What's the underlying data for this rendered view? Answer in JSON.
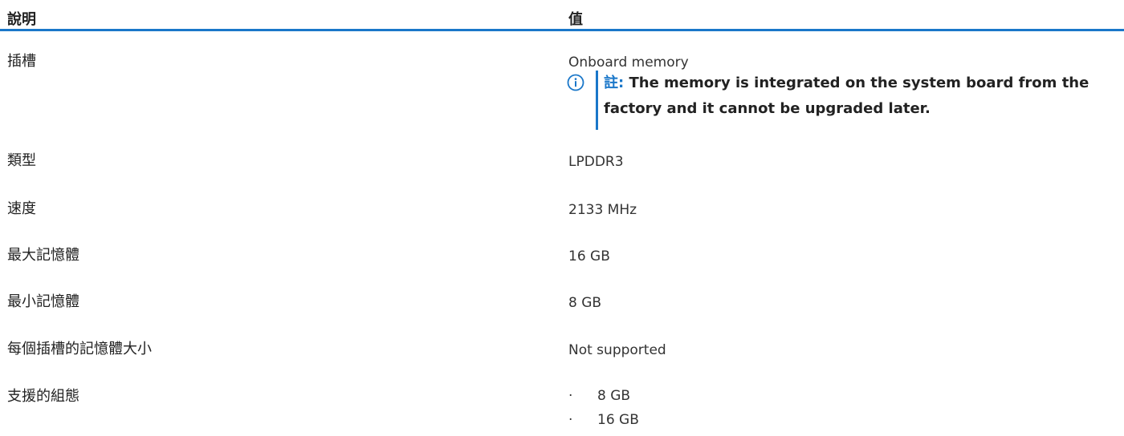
{
  "header": {
    "col1": "說明",
    "col2": "值"
  },
  "rows": [
    {
      "label": "插槽",
      "value": "Onboard memory",
      "note": {
        "prefix": "註:",
        "text": "The memory is integrated on the system board from the factory and it cannot be upgraded later."
      }
    },
    {
      "label": "類型",
      "value": "LPDDR3"
    },
    {
      "label": "速度",
      "value": "2133 MHz"
    },
    {
      "label": "最大記憶體",
      "value": "16 GB"
    },
    {
      "label": "最小記憶體",
      "value": "8 GB"
    },
    {
      "label": "每個插槽的記憶體大小",
      "value": "Not supported"
    },
    {
      "label": "支援的組態",
      "list": [
        "8 GB",
        "16 GB"
      ]
    }
  ],
  "colors": {
    "accent": "#1a77c9"
  },
  "icons": {
    "note": "info-icon"
  }
}
